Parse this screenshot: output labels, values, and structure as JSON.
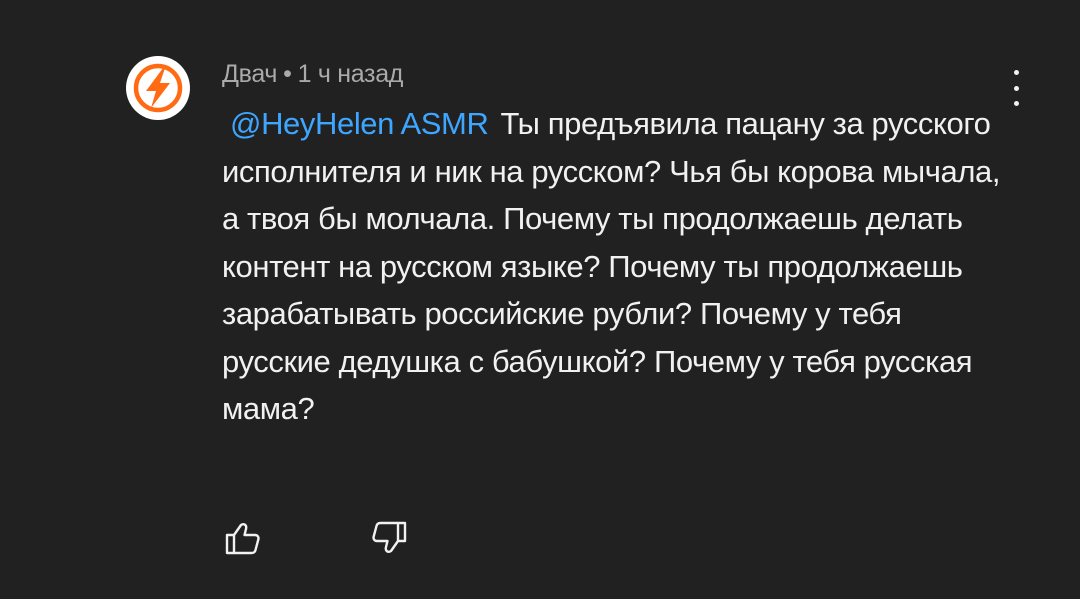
{
  "comment": {
    "author": "Двач",
    "separator": "•",
    "time": "1 ч назад",
    "mention": "@HeyHelen ASMR",
    "text": "Ты предъявила пацану за русского исполнителя и ник на русском? Чья бы корова мычала, а твоя бы молчала. Почему ты продолжаешь делать контент на русском языке? Почему ты продолжаешь зарабатывать российские рубли? Почему у тебя русские дедушка с бабушкой? Почему у тебя русская мама?"
  },
  "icons": {
    "avatar": "lightning-logo-icon",
    "menu": "more-vertical-icon",
    "like": "thumb-up-icon",
    "dislike": "thumb-down-icon"
  },
  "colors": {
    "background": "#212121",
    "text": "#f1f1f1",
    "meta": "#aaaaaa",
    "mention": "#3ea6ff",
    "logo": "#ff6a13"
  }
}
